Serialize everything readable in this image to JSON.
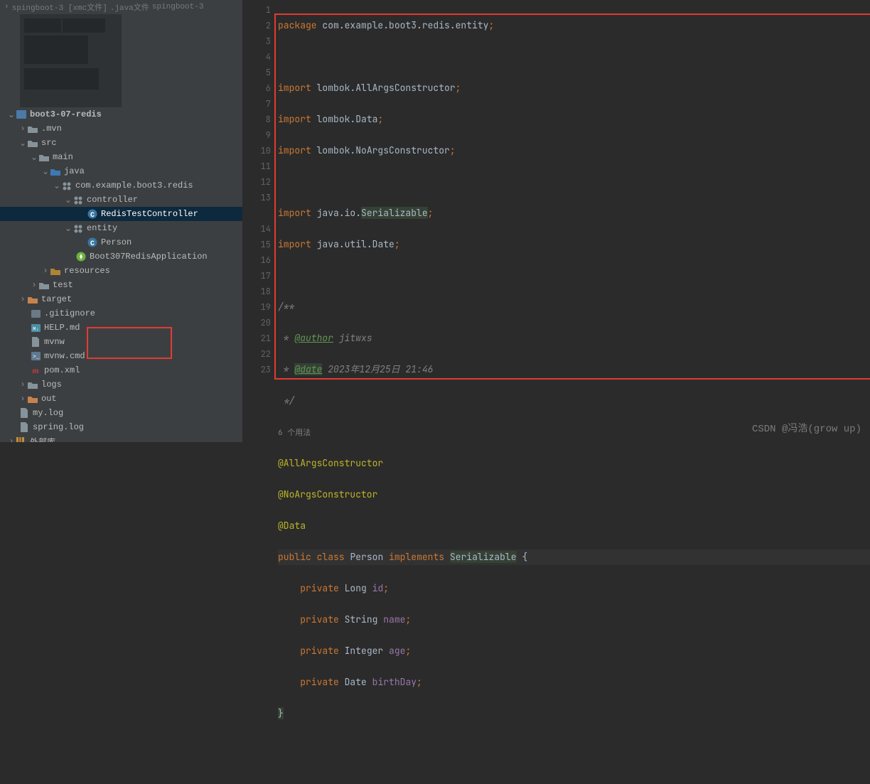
{
  "header": {
    "breadcrumb1": "spingboot-3 [xmc文件]",
    "breadcrumb2": ".java文件",
    "breadcrumb3": "spingboot-3"
  },
  "tree": {
    "project": "boot3-07-redis",
    "mvn": ".mvn",
    "src": "src",
    "main": "main",
    "java": "java",
    "package": "com.example.boot3.redis",
    "controller": "controller",
    "controller_file": "RedisTestController",
    "entity": "entity",
    "entity_file": "Person",
    "app_file": "Boot307RedisApplication",
    "resources": "resources",
    "test": "test",
    "target": "target",
    "gitignore": ".gitignore",
    "help": "HELP.md",
    "mvnw": "mvnw",
    "mvnw_cmd": "mvnw.cmd",
    "pom": "pom.xml",
    "logs": "logs",
    "out": "out",
    "mylog": "my.log",
    "springlog": "spring.log",
    "external": "外部库"
  },
  "gutter": {
    "lines": [
      "1",
      "2",
      "3",
      "4",
      "5",
      "6",
      "7",
      "8",
      "9",
      "10",
      "11",
      "12",
      "13",
      "14",
      "15",
      "16",
      "17",
      "18",
      "19",
      "20",
      "21",
      "22",
      "23"
    ]
  },
  "code": {
    "pkg_kw": "package",
    "pkg_val": "com.example.boot3.redis.entity",
    "imp_kw": "import",
    "imp1": "lombok.",
    "imp1b": "AllArgsConstructor",
    "imp2": "lombok.",
    "imp2b": "Data",
    "imp3": "lombok.",
    "imp3b": "NoArgsConstructor",
    "imp4": "java.io.",
    "imp4b": "Serializable",
    "imp5": "java.util.",
    "imp5b": "Date",
    "cmt_open": "/**",
    "cmt_author_tag": "@author",
    "cmt_author": " jitwxs",
    "cmt_date_tag": "@date",
    "cmt_date": " 2023年12月25日 21:46",
    "cmt_close": " */",
    "usage": "6 个用法",
    "ann1": "@AllArgsConstructor",
    "ann2": "@NoArgsConstructor",
    "ann3": "@Data",
    "pub": "public",
    "cls_kw": "class",
    "cls_name": "Person",
    "impl": "implements",
    "iface": "Serializable",
    "brace_open": " {",
    "priv": "private",
    "t_long": "Long",
    "f_id": "id",
    "t_str": "String",
    "f_name": "name",
    "t_int": "Integer",
    "f_age": "age",
    "t_date": "Date",
    "f_bday": "birthDay",
    "brace_close": "}"
  },
  "watermark": "CSDN @冯浩(grow up)"
}
